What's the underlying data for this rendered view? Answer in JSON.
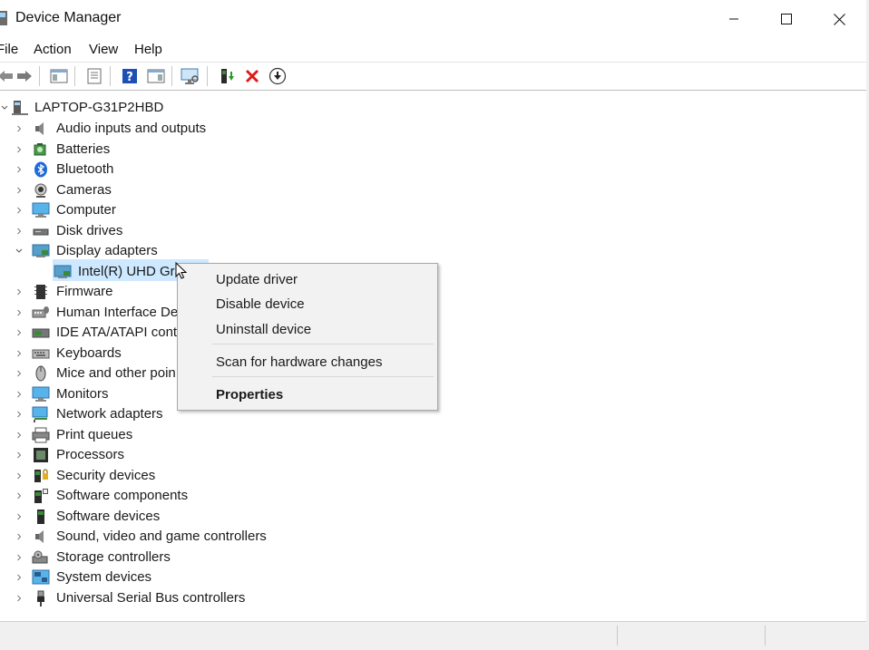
{
  "window": {
    "title": "Device Manager"
  },
  "menu": {
    "file": "File",
    "action": "Action",
    "view": "View",
    "help": "Help"
  },
  "toolbar": {
    "icons": [
      "back-arrow-icon",
      "forward-arrow-icon",
      "show-hide-console-tree-icon",
      "properties-icon",
      "help-icon",
      "action-pane-icon",
      "scan-hardware-icon",
      "update-driver-icon",
      "uninstall-icon",
      "disable-device-icon"
    ]
  },
  "tree": {
    "root": "LAPTOP-G31P2HBD",
    "categories": [
      {
        "label": "Audio inputs and outputs"
      },
      {
        "label": "Batteries"
      },
      {
        "label": "Bluetooth"
      },
      {
        "label": "Cameras"
      },
      {
        "label": "Computer"
      },
      {
        "label": "Disk drives"
      },
      {
        "label": "Display adapters"
      },
      {
        "label": "Intel(R) UHD Grap"
      },
      {
        "label": "Firmware"
      },
      {
        "label": "Human Interface Dev"
      },
      {
        "label": "IDE ATA/ATAPI contro"
      },
      {
        "label": "Keyboards"
      },
      {
        "label": "Mice and other poin"
      },
      {
        "label": "Monitors"
      },
      {
        "label": "Network adapters"
      },
      {
        "label": "Print queues"
      },
      {
        "label": "Processors"
      },
      {
        "label": "Security devices"
      },
      {
        "label": "Software components"
      },
      {
        "label": "Software devices"
      },
      {
        "label": "Sound, video and game controllers"
      },
      {
        "label": "Storage controllers"
      },
      {
        "label": "System devices"
      },
      {
        "label": "Universal Serial Bus controllers"
      }
    ]
  },
  "context_menu": {
    "update_driver": "Update driver",
    "disable_device": "Disable device",
    "uninstall_device": "Uninstall device",
    "scan_hardware": "Scan for hardware changes",
    "properties": "Properties"
  },
  "colors": {
    "selection": "#cde8ff",
    "uninstall_red": "#e01b1b",
    "help_blue": "#1e50b4"
  }
}
